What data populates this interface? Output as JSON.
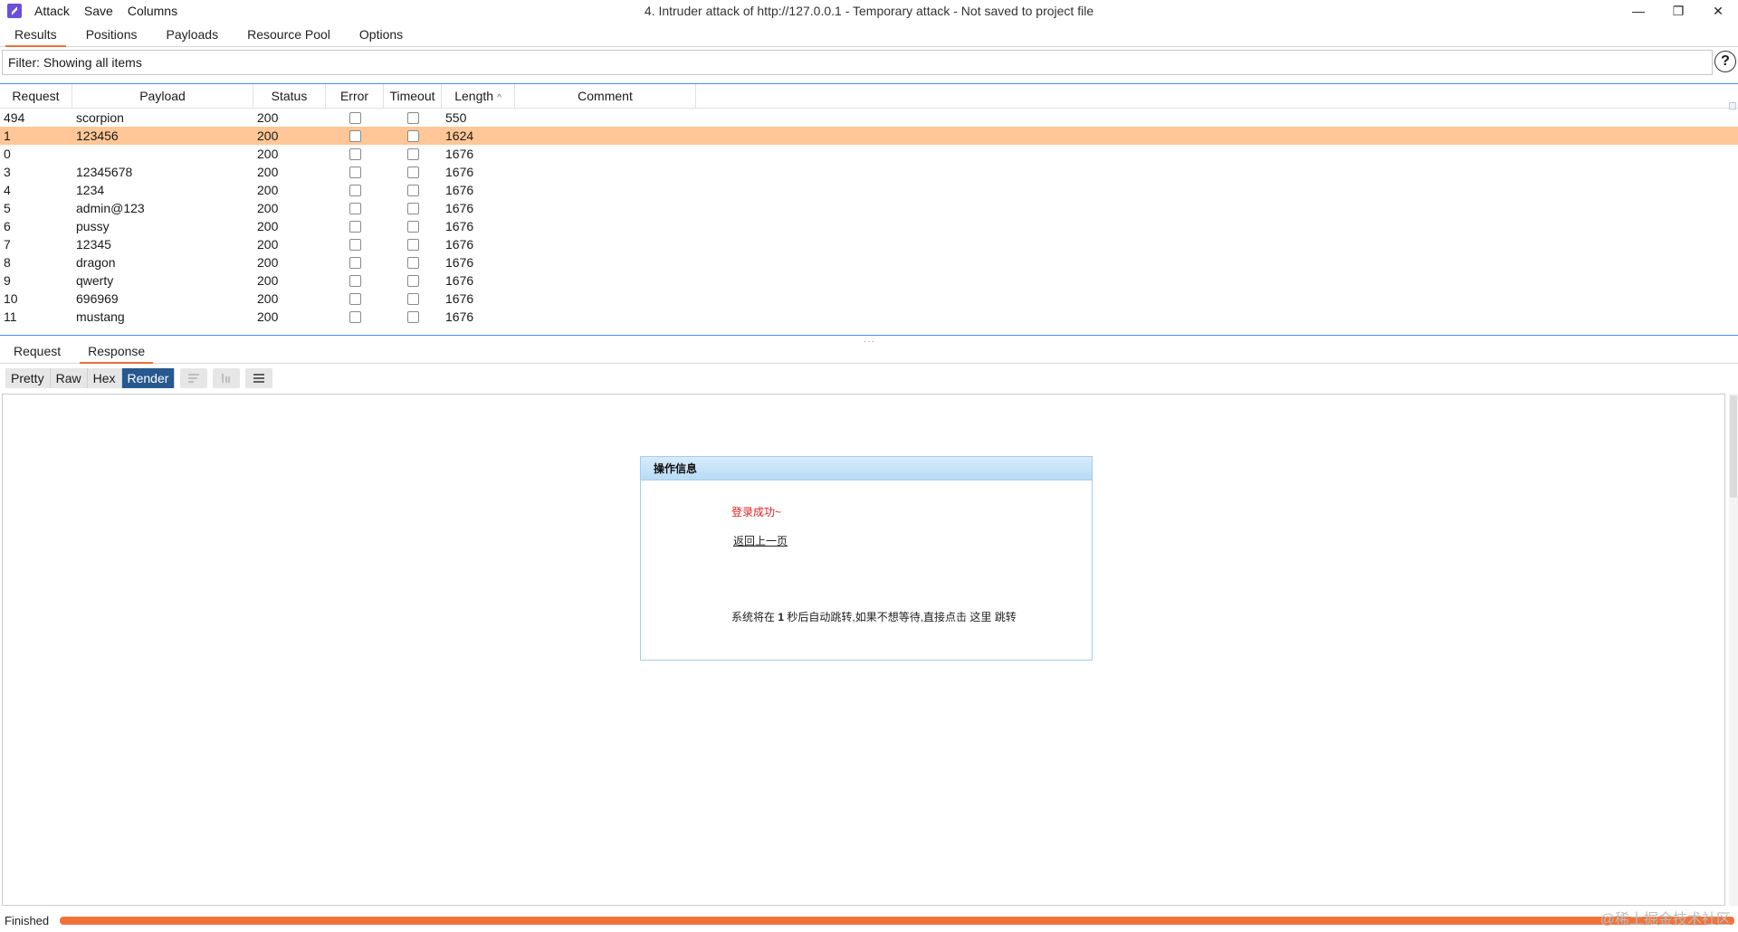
{
  "window": {
    "title": "4. Intruder attack of http://127.0.0.1 - Temporary attack - Not saved to project file",
    "menu": [
      "Attack",
      "Save",
      "Columns"
    ],
    "controls": {
      "minimize": "—",
      "restore": "❐",
      "close": "✕"
    }
  },
  "tabs": [
    "Results",
    "Positions",
    "Payloads",
    "Resource Pool",
    "Options"
  ],
  "filter": {
    "text": "Filter: Showing all items",
    "help": "?"
  },
  "table": {
    "headers": [
      "Request",
      "Payload",
      "Status",
      "Error",
      "Timeout",
      "Length",
      "Comment"
    ],
    "sort_column": "Length",
    "rows": [
      {
        "request": "494",
        "payload": "scorpion",
        "status": "200",
        "length": "550",
        "selected": false
      },
      {
        "request": "1",
        "payload": "123456",
        "status": "200",
        "length": "1624",
        "selected": true
      },
      {
        "request": "0",
        "payload": "",
        "status": "200",
        "length": "1676",
        "selected": false
      },
      {
        "request": "3",
        "payload": "12345678",
        "status": "200",
        "length": "1676",
        "selected": false
      },
      {
        "request": "4",
        "payload": "1234",
        "status": "200",
        "length": "1676",
        "selected": false
      },
      {
        "request": "5",
        "payload": "admin@123",
        "status": "200",
        "length": "1676",
        "selected": false
      },
      {
        "request": "6",
        "payload": "pussy",
        "status": "200",
        "length": "1676",
        "selected": false
      },
      {
        "request": "7",
        "payload": "12345",
        "status": "200",
        "length": "1676",
        "selected": false
      },
      {
        "request": "8",
        "payload": "dragon",
        "status": "200",
        "length": "1676",
        "selected": false
      },
      {
        "request": "9",
        "payload": "qwerty",
        "status": "200",
        "length": "1676",
        "selected": false
      },
      {
        "request": "10",
        "payload": "696969",
        "status": "200",
        "length": "1676",
        "selected": false
      },
      {
        "request": "11",
        "payload": "mustang",
        "status": "200",
        "length": "1676",
        "selected": false
      }
    ]
  },
  "detail_tabs": [
    "Request",
    "Response"
  ],
  "active_detail_tab": "Response",
  "view_modes": [
    "Pretty",
    "Raw",
    "Hex",
    "Render"
  ],
  "active_view_mode": "Render",
  "rendered_page": {
    "panel_title": "操作信息",
    "success": "登录成功~",
    "back_link": "返回上一页",
    "redirect_prefix": "系统将在",
    "redirect_seconds": "1",
    "redirect_suffix": "秒后自动跳转,如果不想等待,直接点击 这里 跳转"
  },
  "status": {
    "text": "Finished",
    "progress": 1.0
  },
  "watermark": "@稀土掘金技术社区",
  "colors": {
    "accent": "#e8733a",
    "selected_row": "#ffc797",
    "active_view": "#26598f",
    "progress": "#f0743a"
  }
}
